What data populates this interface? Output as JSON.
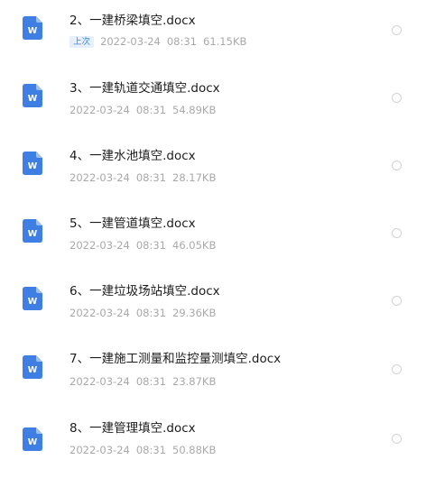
{
  "files": [
    {
      "name": "2、一建桥梁填空.docx",
      "badge": "上次",
      "date": "2022-03-24",
      "time": "08:31",
      "size": "61.15KB"
    },
    {
      "name": "3、一建轨道交通填空.docx",
      "badge": "",
      "date": "2022-03-24",
      "time": "08:31",
      "size": "54.89KB"
    },
    {
      "name": "4、一建水池填空.docx",
      "badge": "",
      "date": "2022-03-24",
      "time": "08:31",
      "size": "28.17KB"
    },
    {
      "name": "5、一建管道填空.docx",
      "badge": "",
      "date": "2022-03-24",
      "time": "08:31",
      "size": "46.05KB"
    },
    {
      "name": "6、一建垃圾场站填空.docx",
      "badge": "",
      "date": "2022-03-24",
      "time": "08:31",
      "size": "29.36KB"
    },
    {
      "name": "7、一建施工测量和监控量测填空.docx",
      "badge": "",
      "date": "2022-03-24",
      "time": "08:31",
      "size": "23.87KB"
    },
    {
      "name": "8、一建管理填空.docx",
      "badge": "",
      "date": "2022-03-24",
      "time": "08:31",
      "size": "50.88KB"
    }
  ],
  "icon": {
    "name": "word-doc-icon",
    "color": "#3f7fe4",
    "letter": "W"
  }
}
